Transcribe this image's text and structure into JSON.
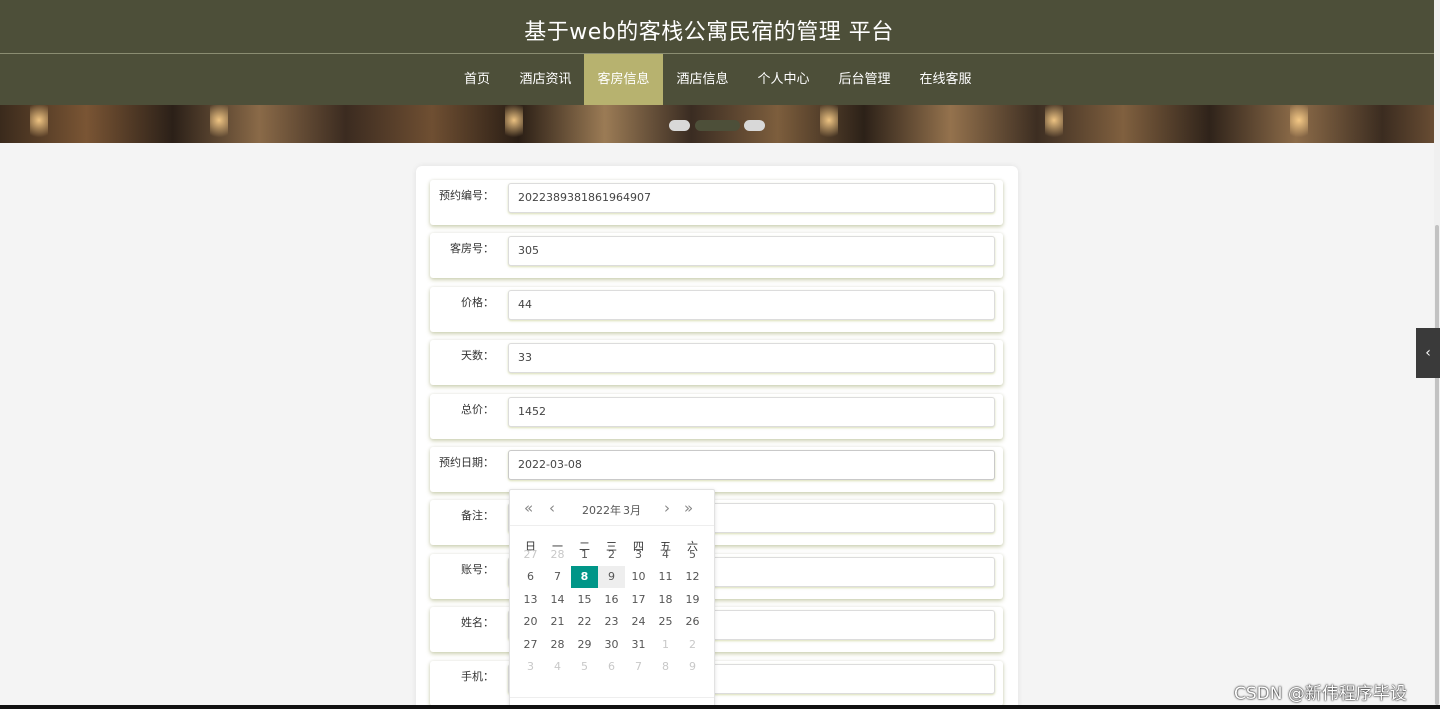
{
  "site": {
    "title": "基于web的客栈公寓民宿的管理 平台"
  },
  "nav": {
    "items": [
      {
        "label": "首页"
      },
      {
        "label": "酒店资讯"
      },
      {
        "label": "客房信息"
      },
      {
        "label": "酒店信息"
      },
      {
        "label": "个人中心"
      },
      {
        "label": "后台管理"
      },
      {
        "label": "在线客服"
      }
    ],
    "active_index": 2
  },
  "banner": {
    "slide_count": 3,
    "active_slide": 2
  },
  "form": {
    "fields": [
      {
        "label": "预约编号：",
        "value": "2022389381861964907"
      },
      {
        "label": "客房号：",
        "value": "305"
      },
      {
        "label": "价格：",
        "value": "44"
      },
      {
        "label": "天数：",
        "value": "33"
      },
      {
        "label": "总价：",
        "value": "1452"
      },
      {
        "label": "预约日期：",
        "value": "2022-03-08"
      },
      {
        "label": "备注：",
        "value": ""
      },
      {
        "label": "账号：",
        "value": ""
      },
      {
        "label": "姓名：",
        "value": ""
      },
      {
        "label": "手机：",
        "value": ""
      }
    ]
  },
  "calendar": {
    "year_label": "2022年",
    "month_label": "3月",
    "prev_year_icon": "«",
    "prev_month_icon": "‹",
    "next_month_icon": "›",
    "next_year_icon": "»",
    "weekdays": [
      "日",
      "一",
      "二",
      "三",
      "四",
      "五",
      "六"
    ],
    "weeks": [
      [
        "27",
        "28",
        "1",
        "2",
        "3",
        "4",
        "5"
      ],
      [
        "6",
        "7",
        "8",
        "9",
        "10",
        "11",
        "12"
      ],
      [
        "13",
        "14",
        "15",
        "16",
        "17",
        "18",
        "19"
      ],
      [
        "20",
        "21",
        "22",
        "23",
        "24",
        "25",
        "26"
      ],
      [
        "27",
        "28",
        "29",
        "30",
        "31",
        "1",
        "2"
      ],
      [
        "3",
        "4",
        "5",
        "6",
        "7",
        "8",
        "9"
      ]
    ],
    "selected_day": "8",
    "hovered_day": "9"
  },
  "side_toggle": {
    "icon": "‹"
  },
  "watermark": {
    "text": "CSDN @新伟程序毕设"
  },
  "colors": {
    "header_bg": "#4d4f39",
    "nav_active_bg": "#b7b26f",
    "calendar_selected": "#009688"
  }
}
